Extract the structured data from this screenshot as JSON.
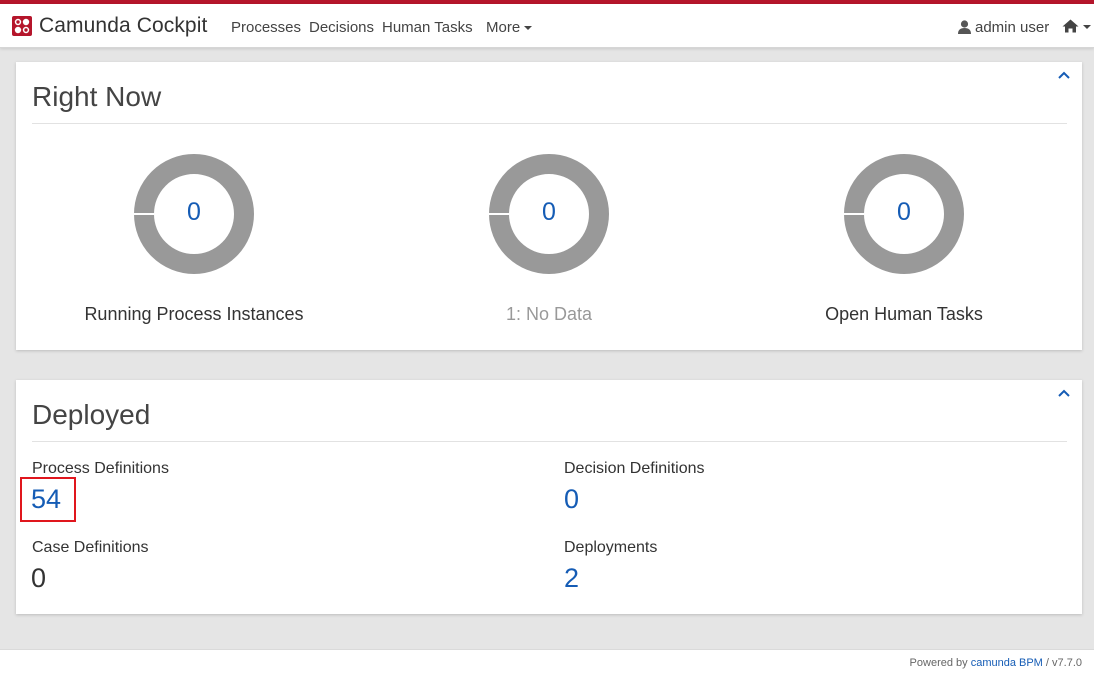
{
  "app": {
    "brand": "Camunda Cockpit",
    "brand_color": "#b5152b"
  },
  "nav": {
    "items": [
      {
        "label": "Processes"
      },
      {
        "label": "Decisions"
      },
      {
        "label": "Human Tasks"
      },
      {
        "label": "More"
      }
    ],
    "user": "admin user"
  },
  "right_now": {
    "title": "Right Now",
    "cards": [
      {
        "value": "0",
        "label": "Running Process Instances"
      },
      {
        "value": "0",
        "label": "1: No Data"
      },
      {
        "value": "0",
        "label": "Open Human Tasks"
      }
    ]
  },
  "deployed": {
    "title": "Deployed",
    "stats": [
      {
        "label": "Process Definitions",
        "value": "54"
      },
      {
        "label": "Decision Definitions",
        "value": "0"
      },
      {
        "label": "Case Definitions",
        "value": "0"
      },
      {
        "label": "Deployments",
        "value": "2"
      }
    ]
  },
  "footer": {
    "prefix": "Powered by ",
    "link": "camunda BPM",
    "version": " / v7.7.0"
  },
  "colors": {
    "accent": "#b5152b",
    "link": "#155cb5",
    "donut": "#999999",
    "highlight": "#e0161d"
  }
}
